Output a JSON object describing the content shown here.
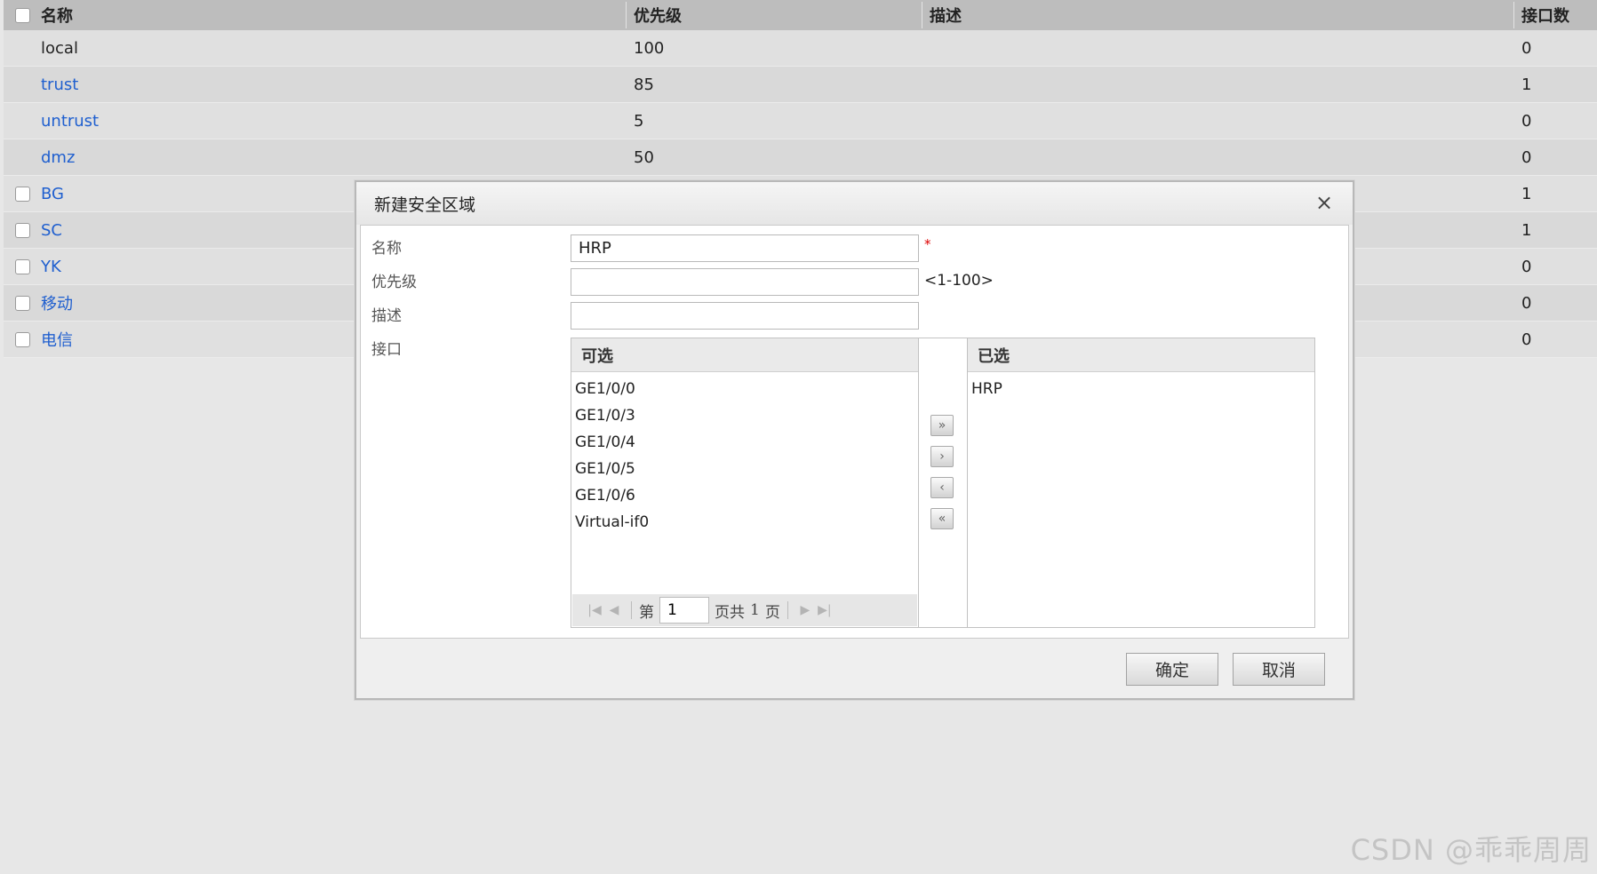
{
  "table": {
    "headers": {
      "name": "名称",
      "priority": "优先级",
      "description": "描述",
      "interfaces": "接口数"
    },
    "rows": [
      {
        "name": "local",
        "priority": "100",
        "description": "",
        "interfaces": "0",
        "checkbox": false,
        "link": false
      },
      {
        "name": "trust",
        "priority": "85",
        "description": "",
        "interfaces": "1",
        "checkbox": false,
        "link": true
      },
      {
        "name": "untrust",
        "priority": "5",
        "description": "",
        "interfaces": "0",
        "checkbox": false,
        "link": true
      },
      {
        "name": "dmz",
        "priority": "50",
        "description": "",
        "interfaces": "0",
        "checkbox": false,
        "link": true
      },
      {
        "name": "BG",
        "priority": "",
        "description": "",
        "interfaces": "1",
        "checkbox": true,
        "link": true
      },
      {
        "name": "SC",
        "priority": "",
        "description": "",
        "interfaces": "1",
        "checkbox": true,
        "link": true
      },
      {
        "name": "YK",
        "priority": "",
        "description": "",
        "interfaces": "0",
        "checkbox": true,
        "link": true
      },
      {
        "name": "移动",
        "priority": "",
        "description": "",
        "interfaces": "0",
        "checkbox": true,
        "link": true
      },
      {
        "name": "电信",
        "priority": "",
        "description": "",
        "interfaces": "0",
        "checkbox": true,
        "link": true
      }
    ]
  },
  "dialog": {
    "title": "新建安全区域",
    "close_glyph": "×",
    "labels": {
      "name": "名称",
      "priority": "优先级",
      "description": "描述",
      "interfaces": "接口"
    },
    "name_value": "HRP",
    "priority_value": "",
    "description_value": "",
    "required_mark": "*",
    "priority_hint": "<1-100>",
    "available": {
      "header": "可选",
      "items": [
        "GE1/0/0",
        "GE1/0/3",
        "GE1/0/4",
        "GE1/0/5",
        "GE1/0/6",
        "Virtual-if0"
      ]
    },
    "selected": {
      "header": "已选",
      "items": [
        "HRP"
      ]
    },
    "pager": {
      "prefix": "第",
      "page": "1",
      "suffix": "页共",
      "total": "1",
      "unit": "页"
    },
    "move_buttons": {
      "add_all": "»",
      "add": "›",
      "remove": "‹",
      "remove_all": "«"
    },
    "ok_label": "确定",
    "cancel_label": "取消"
  },
  "watermark": "CSDN @乖乖周周"
}
